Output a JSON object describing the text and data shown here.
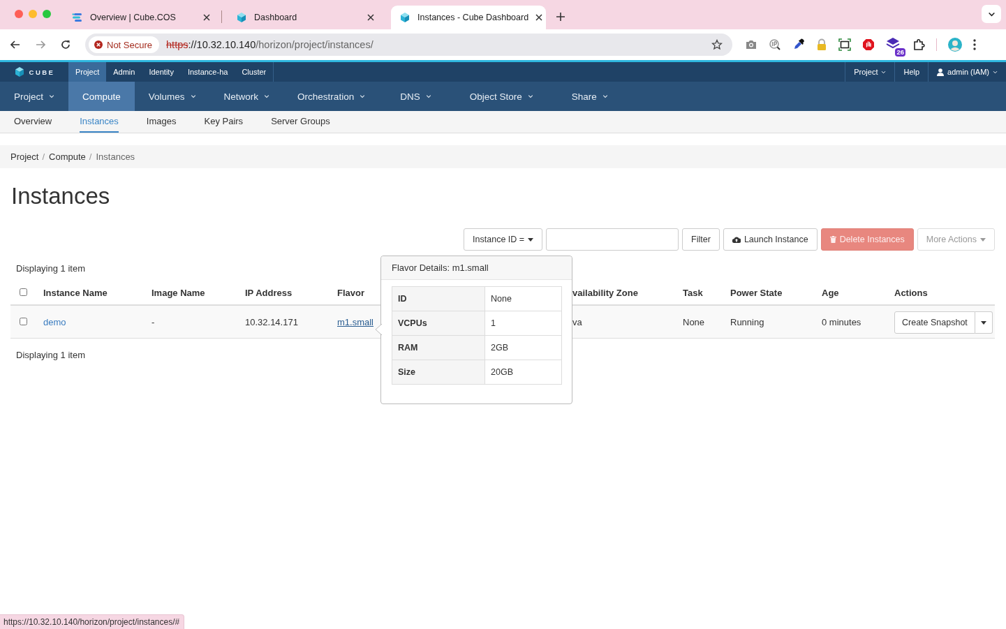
{
  "browser": {
    "tabs": [
      {
        "title": "Overview | Cube.COS",
        "selected": false
      },
      {
        "title": "Dashboard",
        "selected": false
      },
      {
        "title": "Instances - Cube Dashboard",
        "selected": true
      }
    ],
    "security": "Not Secure",
    "url_scheme": "https",
    "url_host": "://10.32.10.140",
    "url_path": "/horizon/project/instances/",
    "extension_badge": "26"
  },
  "topbar": {
    "brand": "CUBE",
    "items": [
      {
        "label": "Project",
        "selected": true
      },
      {
        "label": "Admin",
        "selected": false
      },
      {
        "label": "Identity",
        "selected": false
      },
      {
        "label": "Instance-ha",
        "selected": false
      },
      {
        "label": "Cluster",
        "selected": false
      }
    ],
    "right": [
      {
        "label": "Project",
        "kind": "dropdown"
      },
      {
        "label": "Help",
        "kind": "link"
      },
      {
        "label": "admin (IAM)",
        "kind": "user"
      }
    ]
  },
  "main_nav": [
    {
      "label": "Project",
      "selected": false,
      "dropdown": true
    },
    {
      "label": "Compute",
      "selected": true,
      "dropdown": false
    },
    {
      "label": "Volumes",
      "selected": false,
      "dropdown": true
    },
    {
      "label": "Network",
      "selected": false,
      "dropdown": true
    },
    {
      "label": "Orchestration",
      "selected": false,
      "dropdown": true
    },
    {
      "label": "DNS",
      "selected": false,
      "dropdown": true
    },
    {
      "label": "Object Store",
      "selected": false,
      "dropdown": true
    },
    {
      "label": "Share",
      "selected": false,
      "dropdown": true
    }
  ],
  "sub_nav": [
    {
      "label": "Overview",
      "selected": false
    },
    {
      "label": "Instances",
      "selected": true
    },
    {
      "label": "Images",
      "selected": false
    },
    {
      "label": "Key Pairs",
      "selected": false
    },
    {
      "label": "Server Groups",
      "selected": false
    }
  ],
  "breadcrumb": [
    "Project",
    "Compute",
    "Instances"
  ],
  "breadcrumb_separator": "/",
  "heading": "Instances",
  "toolbar": {
    "filter_field": "Instance ID =",
    "filter_button": "Filter",
    "actions": [
      {
        "label": "Launch Instance",
        "kind": "launch",
        "disabled": false
      },
      {
        "label": "Delete Instances",
        "kind": "delete",
        "disabled": true
      },
      {
        "label": "More Actions",
        "kind": "more",
        "disabled": true
      }
    ]
  },
  "table": {
    "count_top": "Displaying 1 item",
    "count_bottom": "Displaying 1 item",
    "select_all": false,
    "columns": [
      "Instance Name",
      "Image Name",
      "IP Address",
      "Flavor",
      "vailability Zone",
      "Task",
      "Power State",
      "Age",
      "Actions"
    ],
    "rows": [
      {
        "checked": false,
        "name": "demo",
        "image": "-",
        "ip": "10.32.14.171",
        "flavor": "m1.small",
        "zone": "va",
        "task": "None",
        "power_state": "Running",
        "age": "0 minutes",
        "action": "Create Snapshot"
      }
    ]
  },
  "flavor_popover": {
    "title": "Flavor Details: m1.small",
    "rows": [
      {
        "label": "ID",
        "value": "None"
      },
      {
        "label": "VCPUs",
        "value": "1"
      },
      {
        "label": "RAM",
        "value": "2GB"
      },
      {
        "label": "Size",
        "value": "20GB"
      }
    ]
  },
  "status_url": "https://10.32.10.140/horizon/project/instances/#"
}
